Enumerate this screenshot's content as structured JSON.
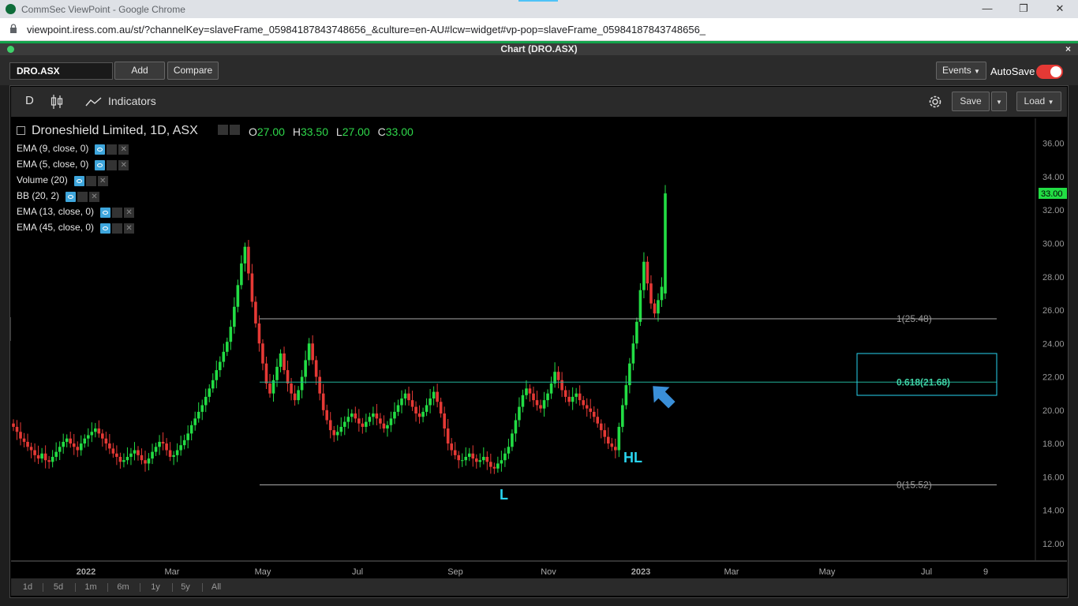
{
  "browser": {
    "window_title": "CommSec ViewPoint - Google Chrome",
    "url": "viewpoint.iress.com.au/st/?channelKey=slaveFrame_05984187843748656_&culture=en-AU#lcw=widget#vp-pop=slaveFrame_05984187843748656_"
  },
  "panel": {
    "title": "Chart (DRO.ASX)",
    "close": "×"
  },
  "toolbar": {
    "symbol_value": "DRO.ASX",
    "add_label": "Add",
    "compare_label": "Compare",
    "events_label": "Events",
    "autosave_label": "AutoSave",
    "autosave_on": true
  },
  "chart_toolbar": {
    "interval": "D",
    "indicators_label": "Indicators",
    "save_label": "Save",
    "load_label": "Load"
  },
  "legend": {
    "title": "Droneshield Limited, 1D, ASX",
    "o_label": "O",
    "o_value": "27.00",
    "h_label": "H",
    "h_value": "33.50",
    "l_label": "L",
    "l_value": "27.00",
    "c_label": "C",
    "c_value": "33.00",
    "indicators": [
      "EMA (9, close, 0)",
      "EMA (5, close, 0)",
      "Volume (20)",
      "BB (20, 2)",
      "EMA (13, close, 0)",
      "EMA (45, close, 0)"
    ]
  },
  "range_buttons": [
    "1d",
    "5d",
    "1m",
    "6m",
    "1y",
    "5y",
    "All"
  ],
  "colors": {
    "up": "#22dd44",
    "down": "#e53935",
    "accent": "#3ea6dc",
    "annotation": "#29d4ef"
  },
  "chart_data": {
    "type": "candlestick",
    "title": "Droneshield Limited, 1D, ASX",
    "ylim": [
      11,
      37.5
    ],
    "y_ticks": [
      "12.00",
      "14.00",
      "16.00",
      "18.00",
      "20.00",
      "22.00",
      "24.00",
      "26.00",
      "28.00",
      "30.00",
      "32.00",
      "34.00",
      "36.00"
    ],
    "x_tick_labels": [
      "2022",
      "Mar",
      "May",
      "Jul",
      "Sep",
      "Nov",
      "2023",
      "Mar",
      "May",
      "Jul",
      "9"
    ],
    "last_price": "33.00",
    "fib_levels": [
      {
        "label": "1(25.48)",
        "value": 25.48
      },
      {
        "label": "0.618(21.68)",
        "value": 21.68
      },
      {
        "label": "0(15.52)",
        "value": 15.52
      }
    ],
    "annotations": [
      {
        "text": "L",
        "near_value": 15.5
      },
      {
        "text": "HL",
        "near_value": 17.5
      }
    ],
    "ohlc_closes": [
      19,
      18.7,
      18.3,
      18.1,
      17.8,
      17.6,
      17.3,
      17.1,
      17.4,
      17.0,
      16.9,
      17.2,
      17.5,
      17.8,
      18.1,
      18.3,
      18.0,
      17.8,
      17.6,
      18.0,
      18.3,
      18.5,
      18.7,
      18.9,
      18.6,
      18.3,
      18.0,
      17.7,
      17.4,
      17.2,
      16.9,
      17.0,
      17.2,
      17.4,
      17.6,
      17.3,
      17.0,
      16.8,
      17.1,
      17.5,
      17.8,
      18.1,
      18.0,
      17.6,
      17.2,
      17.3,
      17.6,
      17.9,
      18.2,
      18.6,
      19.1,
      19.5,
      19.9,
      20.3,
      20.8,
      21.3,
      21.8,
      22.4,
      22.9,
      23.5,
      24.1,
      25.0,
      26.2,
      27.5,
      28.8,
      29.8,
      28.2,
      26.5,
      25.2,
      24.0,
      22.8,
      21.6,
      21.0,
      21.8,
      22.6,
      23.4,
      22.4,
      21.6,
      21.0,
      20.6,
      21.2,
      22.0,
      23.0,
      24.0,
      23.0,
      22.0,
      21.0,
      20.0,
      19.4,
      18.8,
      18.5,
      18.7,
      19.0,
      19.3,
      19.6,
      19.8,
      19.5,
      19.2,
      19.0,
      19.3,
      19.6,
      19.8,
      19.5,
      19.2,
      18.9,
      19.1,
      19.5,
      19.9,
      20.3,
      20.7,
      21.0,
      20.6,
      20.2,
      19.8,
      19.6,
      19.9,
      20.3,
      20.7,
      21.1,
      20.5,
      19.8,
      18.9,
      18.0,
      17.6,
      17.3,
      17.0,
      17.0,
      17.2,
      17.4,
      17.1,
      16.9,
      17.0,
      17.2,
      16.9,
      16.6,
      16.5,
      16.8,
      17.0,
      17.4,
      17.8,
      18.6,
      19.4,
      20.2,
      20.9,
      21.3,
      21.0,
      20.6,
      20.3,
      20.1,
      20.6,
      21.0,
      21.6,
      22.3,
      21.8,
      21.2,
      20.8,
      20.5,
      20.8,
      21.0,
      20.6,
      20.3,
      20.1,
      19.9,
      19.6,
      19.2,
      18.8,
      18.4,
      18.0,
      17.8,
      17.6,
      19.0,
      20.3,
      21.5,
      22.8,
      24.0,
      25.3,
      27.2,
      28.9,
      27.6,
      26.4,
      25.8,
      26.6,
      27.4,
      33.0
    ]
  }
}
